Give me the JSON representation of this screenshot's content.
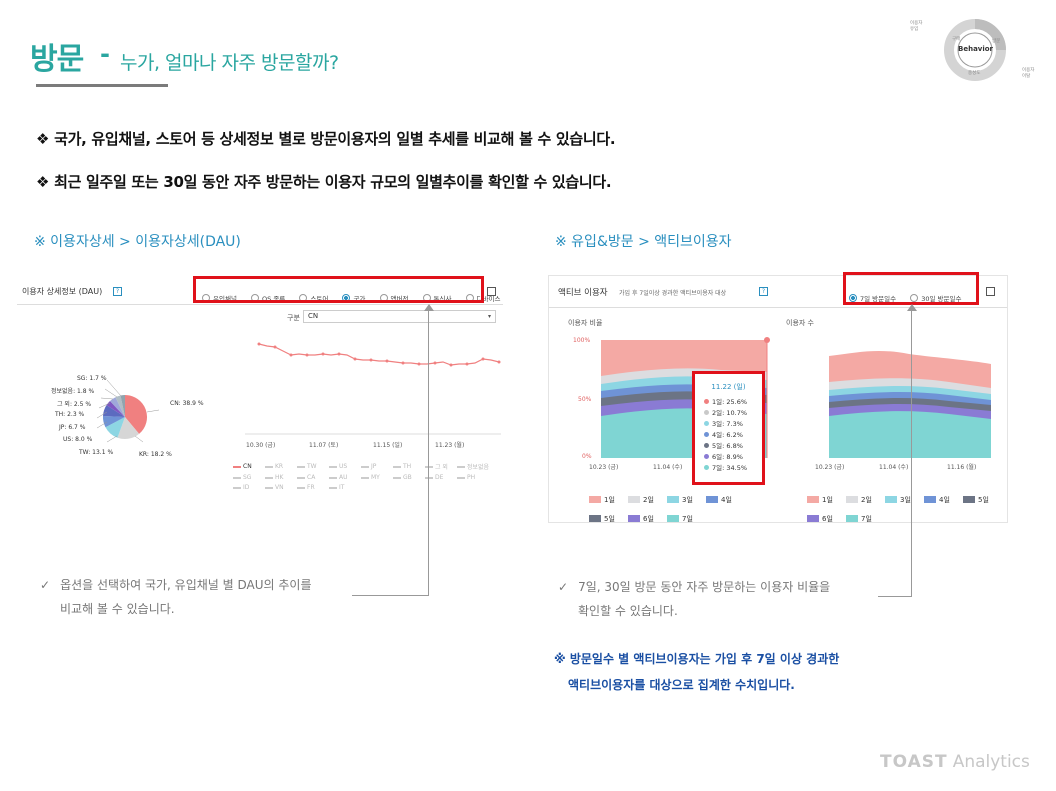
{
  "title": {
    "main": "방문",
    "dash": "-",
    "sub": "누가, 얼마나 자주 방문할까?"
  },
  "cycle_diagram": {
    "center": "Behavior",
    "top_left": "이용자\n유입",
    "left": "구매",
    "right": "방문",
    "bottom": "충성도",
    "bottom_right": "이용자\n이탈"
  },
  "bullets": [
    "❖ 국가, 유입채널, 스토어 등 상세정보 별로 방문이용자의 일별 추세를 비교해 볼 수 있습니다.",
    "❖ 최근 일주일 또는 30일 동안 자주 방문하는 이용자 규모의 일별추이를 확인할 수 있습니다."
  ],
  "left_section": {
    "heading": "※ 이용자상세 > 이용자상세(DAU)",
    "card_title": "이용자 상세정보 (DAU)",
    "help": "?",
    "options": [
      "유입채널",
      "OS 종류",
      "스토어",
      "국가",
      "앱버전",
      "통신사",
      "디바이스"
    ],
    "selected_option": "국가",
    "filter_label": "구분",
    "filter_value": "CN",
    "pie_labels": [
      "SG: 1.7 %",
      "정보없음: 1.8 %",
      "그 외: 2.5 %",
      "TH: 2.3 %",
      "JP: 6.7 %",
      "US: 8.0 %",
      "TW: 13.1 %",
      "KR: 18.2 %",
      "CN: 38.9 %"
    ],
    "x_ticks": [
      "10.30 (금)",
      "11.07 (토)",
      "11.15 (일)",
      "11.23 (월)"
    ],
    "legend_rows": [
      [
        "CN",
        "KR",
        "TW",
        "US",
        "JP",
        "TH",
        "그 외",
        "정보없음"
      ],
      [
        "SG",
        "HK",
        "CA",
        "AU",
        "MY",
        "GB",
        "DE",
        "PH"
      ],
      [
        "ID",
        "VN",
        "FR",
        "IT"
      ]
    ],
    "note": [
      "옵션을 선택하여 국가, 유입채널 별 DAU의 추이를",
      "비교해 볼 수 있습니다."
    ]
  },
  "right_section": {
    "heading": "※ 유입&방문 > 액티브이용자",
    "card_title": "액티브 이용자",
    "card_subtitle": "가입 후 7일이상 경과한 액티브이용자 대상",
    "help": "?",
    "options": [
      "7일 방문일수",
      "30일 방문일수"
    ],
    "selected_option": "7일 방문일수",
    "ratio_label": "이용자 비율",
    "count_label": "이용자 수",
    "y_ticks": [
      "100%",
      "50%",
      "0%"
    ],
    "x_ticks_ratio": [
      "10.23 (금)",
      "11.04 (수)"
    ],
    "x_ticks_count": [
      "10.23 (금)",
      "11.04 (수)",
      "11.16 (월)"
    ],
    "tooltip": {
      "date": "11.22 (일)",
      "rows": [
        "1일: 25.6%",
        "2일: 10.7%",
        "3일: 7.3%",
        "4일: 6.2%",
        "5일: 6.8%",
        "6일: 8.9%",
        "7일: 34.5%"
      ]
    },
    "legend": [
      "1일",
      "2일",
      "3일",
      "4일",
      "5일",
      "6일",
      "7일"
    ],
    "note": [
      "7일, 30일 방문 동안 자주 방문하는 이용자 비율을",
      "확인할 수 있습니다."
    ],
    "blue_note": [
      "※ 방문일수 별 액티브이용자는 가입 후 7일 이상 경과한",
      "액티브이용자를 대상으로 집계한 수치입니다."
    ]
  },
  "brand": {
    "logo": "TOAST",
    "product": "Analytics"
  },
  "colors": {
    "accent": "#2aa6a0",
    "red": "#e0111a",
    "d1": "#f4a9a4",
    "d2": "#dcdde0",
    "d3": "#8dd6e3",
    "d4": "#6f93d6",
    "d5": "#6c7485",
    "d6": "#8a7bd4",
    "d7": "#7fd5d3"
  }
}
